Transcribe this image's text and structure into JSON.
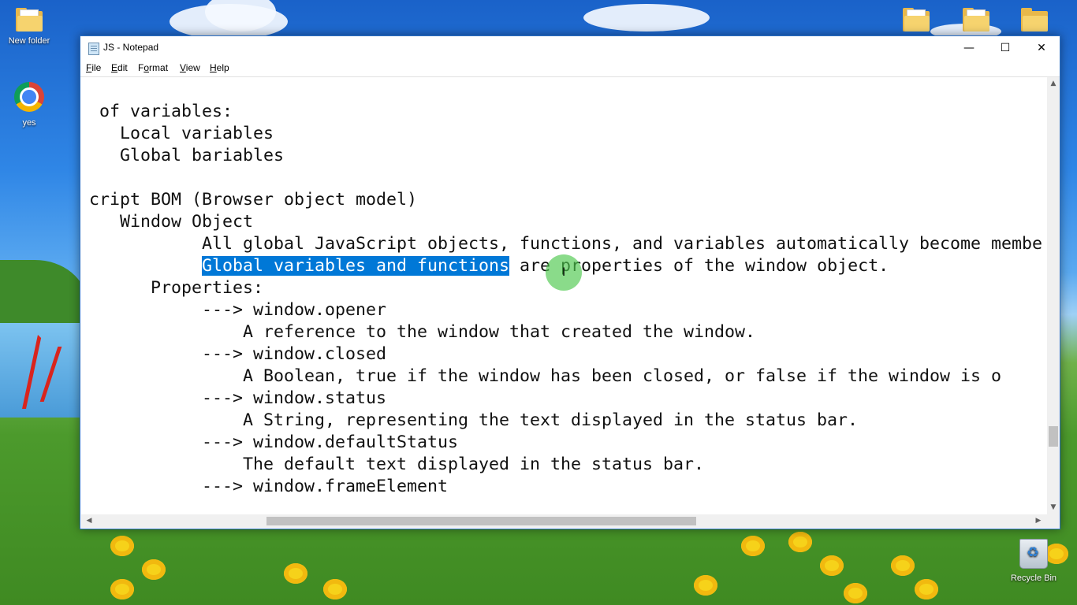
{
  "desktop": {
    "icons": [
      {
        "label": "New folder",
        "icon": "folder-icon"
      },
      {
        "label": "yes",
        "icon": "chrome-icon"
      },
      {
        "label": "Recycle Bin",
        "icon": "recycle-bin-icon"
      }
    ]
  },
  "window": {
    "title": "JS - Notepad",
    "controls": {
      "minimize": "—",
      "maximize": "☐",
      "close": "✕"
    },
    "menu": [
      {
        "label": "File",
        "accel": "F",
        "rest": "ile"
      },
      {
        "label": "Edit",
        "accel": "E",
        "rest": "dit"
      },
      {
        "label": "Format",
        "accel": "o",
        "pre": "F",
        "rest": "rmat"
      },
      {
        "label": "View",
        "accel": "V",
        "rest": "iew"
      },
      {
        "label": "Help",
        "accel": "H",
        "rest": "elp"
      }
    ]
  },
  "editor": {
    "lines": [
      " of variables:",
      "   Local variables",
      "   Global bariables",
      "",
      "cript BOM (Browser object model)",
      "   Window Object",
      "           All global JavaScript objects, functions, and variables automatically become membe",
      "",
      "      Properties:",
      "           ---> window.opener",
      "               A reference to the window that created the window.",
      "           ---> window.closed",
      "               A Boolean, true if the window has been closed, or false if the window is o",
      "           ---> window.status",
      "               A String, representing the text displayed in the status bar.",
      "           ---> window.defaultStatus",
      "               The default text displayed in the status bar.",
      "           ---> window.frameElement"
    ],
    "selected_line": {
      "indent": "           ",
      "selected": "Global variables and functions",
      "after": " are properties of the window object."
    }
  },
  "scrollbars": {
    "up": "▲",
    "down": "▼",
    "left": "◀",
    "right": "▶"
  }
}
